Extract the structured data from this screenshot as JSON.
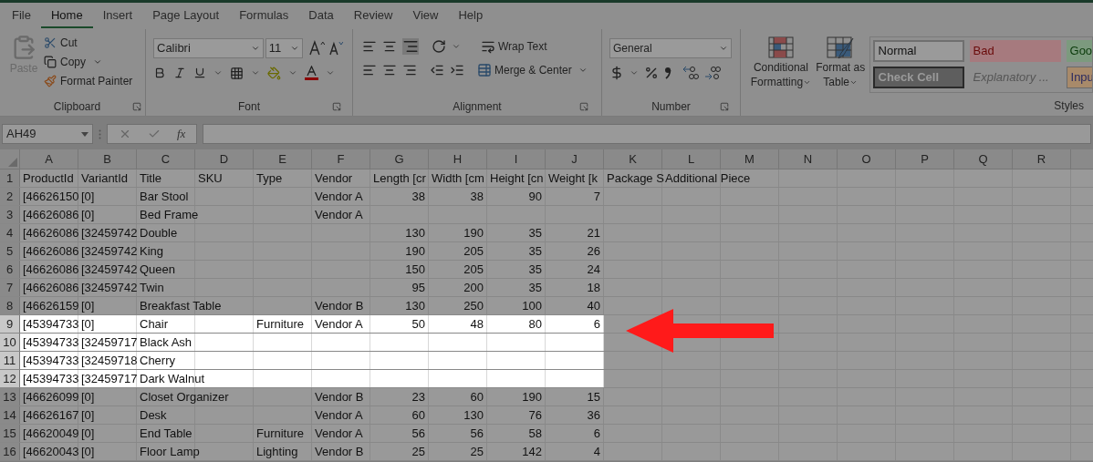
{
  "menu_tabs": [
    {
      "label": "File",
      "selected": false
    },
    {
      "label": "Home",
      "selected": true
    },
    {
      "label": "Insert",
      "selected": false
    },
    {
      "label": "Page Layout",
      "selected": false
    },
    {
      "label": "Formulas",
      "selected": false
    },
    {
      "label": "Data",
      "selected": false
    },
    {
      "label": "Review",
      "selected": false
    },
    {
      "label": "View",
      "selected": false
    },
    {
      "label": "Help",
      "selected": false
    }
  ],
  "ribbon": {
    "clipboard": {
      "paste": {
        "label": "Paste",
        "disabled": true
      },
      "cut": "Cut",
      "copy": "Copy",
      "format_painter": "Format Painter",
      "label": "Clipboard"
    },
    "font": {
      "name": "Calibri",
      "size": "11",
      "label": "Font"
    },
    "alignment": {
      "wrap_text": "Wrap Text",
      "merge_center": "Merge & Center",
      "label": "Alignment"
    },
    "number": {
      "format": "General",
      "label": "Number"
    },
    "styles": {
      "conditional_formatting": [
        "Conditional",
        "Formatting"
      ],
      "format_as_table": [
        "Format as",
        "Table"
      ],
      "label": "Styles",
      "cell_styles": [
        {
          "label": "Normal",
          "kind": "normal"
        },
        {
          "label": "Bad",
          "kind": "bad"
        },
        {
          "label": "Goo",
          "kind": "good"
        },
        {
          "label": "Check Cell",
          "kind": "check"
        },
        {
          "label": "Explanatory ...",
          "kind": "explanatory"
        },
        {
          "label": "Inpu",
          "kind": "input"
        }
      ]
    }
  },
  "formula_bar": {
    "name_box": "AH49",
    "fx": "fx"
  },
  "sheet": {
    "columns": [
      "A",
      "B",
      "C",
      "D",
      "E",
      "F",
      "G",
      "H",
      "I",
      "J",
      "K",
      "L",
      "M",
      "N",
      "O",
      "P",
      "Q",
      "R"
    ],
    "rows": [
      {
        "number": "1",
        "highlighted": false,
        "text": {
          "A": "ProductId",
          "B": "VariantId",
          "C": "Title",
          "D": "SKU",
          "E": "Type",
          "F": "Vendor",
          "G": "Length [cr",
          "H": "Width [cm",
          "I": "Height [cn",
          "J": "Weight [k",
          "K": "Package S",
          "L": "Additional Piece"
        }
      },
      {
        "number": "2",
        "highlighted": false,
        "text": {
          "A": "[46626150",
          "B": "[0]",
          "C": "Bar Stool",
          "F": "Vendor A"
        },
        "numbers": {
          "G": "38",
          "H": "38",
          "I": "90",
          "J": "7"
        }
      },
      {
        "number": "3",
        "highlighted": false,
        "text": {
          "A": "[46626086",
          "B": "[0]",
          "C": "Bed Frame",
          "F": "Vendor A"
        }
      },
      {
        "number": "4",
        "highlighted": false,
        "text": {
          "A": "[46626086",
          "B": "[32459742",
          "C": "Double"
        },
        "numbers": {
          "G": "130",
          "H": "190",
          "I": "35",
          "J": "21"
        }
      },
      {
        "number": "5",
        "highlighted": false,
        "text": {
          "A": "[46626086",
          "B": "[32459742",
          "C": "King"
        },
        "numbers": {
          "G": "190",
          "H": "205",
          "I": "35",
          "J": "26"
        }
      },
      {
        "number": "6",
        "highlighted": false,
        "text": {
          "A": "[46626086",
          "B": "[32459742",
          "C": "Queen"
        },
        "numbers": {
          "G": "150",
          "H": "205",
          "I": "35",
          "J": "24"
        }
      },
      {
        "number": "7",
        "highlighted": false,
        "text": {
          "A": "[46626086",
          "B": "[32459742",
          "C": "Twin"
        },
        "numbers": {
          "G": "95",
          "H": "200",
          "I": "35",
          "J": "18"
        }
      },
      {
        "number": "8",
        "highlighted": false,
        "text": {
          "A": "[46626159",
          "B": "[0]",
          "C": "Breakfast Table",
          "F": "Vendor B"
        },
        "numbers": {
          "G": "130",
          "H": "250",
          "I": "100",
          "J": "40"
        }
      },
      {
        "number": "9",
        "highlighted": true,
        "text": {
          "A": "[45394733",
          "B": "[0]",
          "C": "Chair",
          "E": "Furniture",
          "F": "Vendor A"
        },
        "numbers": {
          "G": "50",
          "H": "48",
          "I": "80",
          "J": "6"
        }
      },
      {
        "number": "10",
        "highlighted": true,
        "text": {
          "A": "[45394733",
          "B": "[32459717",
          "C": "Black Ash"
        }
      },
      {
        "number": "11",
        "highlighted": true,
        "text": {
          "A": "[45394733",
          "B": "[32459718",
          "C": "Cherry"
        }
      },
      {
        "number": "12",
        "highlighted": true,
        "text": {
          "A": "[45394733",
          "B": "[32459717",
          "C": "Dark Walnut"
        }
      },
      {
        "number": "13",
        "highlighted": false,
        "text": {
          "A": "[46626099",
          "B": "[0]",
          "C": "Closet Organizer",
          "F": "Vendor B"
        },
        "numbers": {
          "G": "23",
          "H": "60",
          "I": "190",
          "J": "15"
        }
      },
      {
        "number": "14",
        "highlighted": false,
        "text": {
          "A": "[46626167",
          "B": "[0]",
          "C": "Desk",
          "F": "Vendor A"
        },
        "numbers": {
          "G": "60",
          "H": "130",
          "I": "76",
          "J": "36"
        }
      },
      {
        "number": "15",
        "highlighted": false,
        "text": {
          "A": "[46620049",
          "B": "[0]",
          "C": "End Table",
          "E": "Furniture",
          "F": "Vendor A"
        },
        "numbers": {
          "G": "56",
          "H": "56",
          "I": "58",
          "J": "6"
        }
      },
      {
        "number": "16",
        "highlighted": false,
        "text": {
          "A": "[46620043",
          "B": "[0]",
          "C": "Floor Lamp",
          "E": "Lighting",
          "F": "Vendor B"
        },
        "numbers": {
          "G": "25",
          "H": "25",
          "I": "142",
          "J": "4"
        }
      }
    ]
  }
}
